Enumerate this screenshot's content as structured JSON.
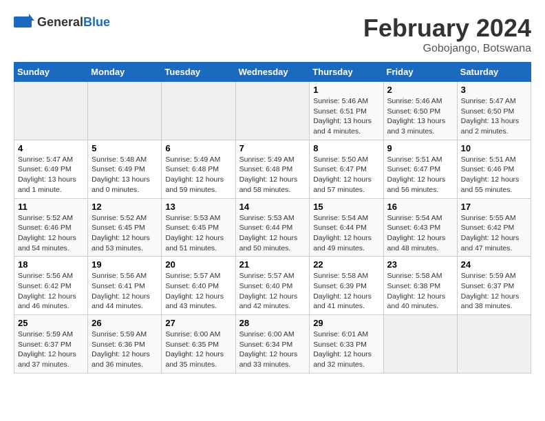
{
  "header": {
    "logo_general": "General",
    "logo_blue": "Blue",
    "title": "February 2024",
    "subtitle": "Gobojango, Botswana"
  },
  "calendar": {
    "days_of_week": [
      "Sunday",
      "Monday",
      "Tuesday",
      "Wednesday",
      "Thursday",
      "Friday",
      "Saturday"
    ],
    "weeks": [
      [
        {
          "day": "",
          "info": ""
        },
        {
          "day": "",
          "info": ""
        },
        {
          "day": "",
          "info": ""
        },
        {
          "day": "",
          "info": ""
        },
        {
          "day": "1",
          "info": "Sunrise: 5:46 AM\nSunset: 6:51 PM\nDaylight: 13 hours\nand 4 minutes."
        },
        {
          "day": "2",
          "info": "Sunrise: 5:46 AM\nSunset: 6:50 PM\nDaylight: 13 hours\nand 3 minutes."
        },
        {
          "day": "3",
          "info": "Sunrise: 5:47 AM\nSunset: 6:50 PM\nDaylight: 13 hours\nand 2 minutes."
        }
      ],
      [
        {
          "day": "4",
          "info": "Sunrise: 5:47 AM\nSunset: 6:49 PM\nDaylight: 13 hours\nand 1 minute."
        },
        {
          "day": "5",
          "info": "Sunrise: 5:48 AM\nSunset: 6:49 PM\nDaylight: 13 hours\nand 0 minutes."
        },
        {
          "day": "6",
          "info": "Sunrise: 5:49 AM\nSunset: 6:48 PM\nDaylight: 12 hours\nand 59 minutes."
        },
        {
          "day": "7",
          "info": "Sunrise: 5:49 AM\nSunset: 6:48 PM\nDaylight: 12 hours\nand 58 minutes."
        },
        {
          "day": "8",
          "info": "Sunrise: 5:50 AM\nSunset: 6:47 PM\nDaylight: 12 hours\nand 57 minutes."
        },
        {
          "day": "9",
          "info": "Sunrise: 5:51 AM\nSunset: 6:47 PM\nDaylight: 12 hours\nand 56 minutes."
        },
        {
          "day": "10",
          "info": "Sunrise: 5:51 AM\nSunset: 6:46 PM\nDaylight: 12 hours\nand 55 minutes."
        }
      ],
      [
        {
          "day": "11",
          "info": "Sunrise: 5:52 AM\nSunset: 6:46 PM\nDaylight: 12 hours\nand 54 minutes."
        },
        {
          "day": "12",
          "info": "Sunrise: 5:52 AM\nSunset: 6:45 PM\nDaylight: 12 hours\nand 53 minutes."
        },
        {
          "day": "13",
          "info": "Sunrise: 5:53 AM\nSunset: 6:45 PM\nDaylight: 12 hours\nand 51 minutes."
        },
        {
          "day": "14",
          "info": "Sunrise: 5:53 AM\nSunset: 6:44 PM\nDaylight: 12 hours\nand 50 minutes."
        },
        {
          "day": "15",
          "info": "Sunrise: 5:54 AM\nSunset: 6:44 PM\nDaylight: 12 hours\nand 49 minutes."
        },
        {
          "day": "16",
          "info": "Sunrise: 5:54 AM\nSunset: 6:43 PM\nDaylight: 12 hours\nand 48 minutes."
        },
        {
          "day": "17",
          "info": "Sunrise: 5:55 AM\nSunset: 6:42 PM\nDaylight: 12 hours\nand 47 minutes."
        }
      ],
      [
        {
          "day": "18",
          "info": "Sunrise: 5:56 AM\nSunset: 6:42 PM\nDaylight: 12 hours\nand 46 minutes."
        },
        {
          "day": "19",
          "info": "Sunrise: 5:56 AM\nSunset: 6:41 PM\nDaylight: 12 hours\nand 44 minutes."
        },
        {
          "day": "20",
          "info": "Sunrise: 5:57 AM\nSunset: 6:40 PM\nDaylight: 12 hours\nand 43 minutes."
        },
        {
          "day": "21",
          "info": "Sunrise: 5:57 AM\nSunset: 6:40 PM\nDaylight: 12 hours\nand 42 minutes."
        },
        {
          "day": "22",
          "info": "Sunrise: 5:58 AM\nSunset: 6:39 PM\nDaylight: 12 hours\nand 41 minutes."
        },
        {
          "day": "23",
          "info": "Sunrise: 5:58 AM\nSunset: 6:38 PM\nDaylight: 12 hours\nand 40 minutes."
        },
        {
          "day": "24",
          "info": "Sunrise: 5:59 AM\nSunset: 6:37 PM\nDaylight: 12 hours\nand 38 minutes."
        }
      ],
      [
        {
          "day": "25",
          "info": "Sunrise: 5:59 AM\nSunset: 6:37 PM\nDaylight: 12 hours\nand 37 minutes."
        },
        {
          "day": "26",
          "info": "Sunrise: 5:59 AM\nSunset: 6:36 PM\nDaylight: 12 hours\nand 36 minutes."
        },
        {
          "day": "27",
          "info": "Sunrise: 6:00 AM\nSunset: 6:35 PM\nDaylight: 12 hours\nand 35 minutes."
        },
        {
          "day": "28",
          "info": "Sunrise: 6:00 AM\nSunset: 6:34 PM\nDaylight: 12 hours\nand 33 minutes."
        },
        {
          "day": "29",
          "info": "Sunrise: 6:01 AM\nSunset: 6:33 PM\nDaylight: 12 hours\nand 32 minutes."
        },
        {
          "day": "",
          "info": ""
        },
        {
          "day": "",
          "info": ""
        }
      ]
    ]
  }
}
